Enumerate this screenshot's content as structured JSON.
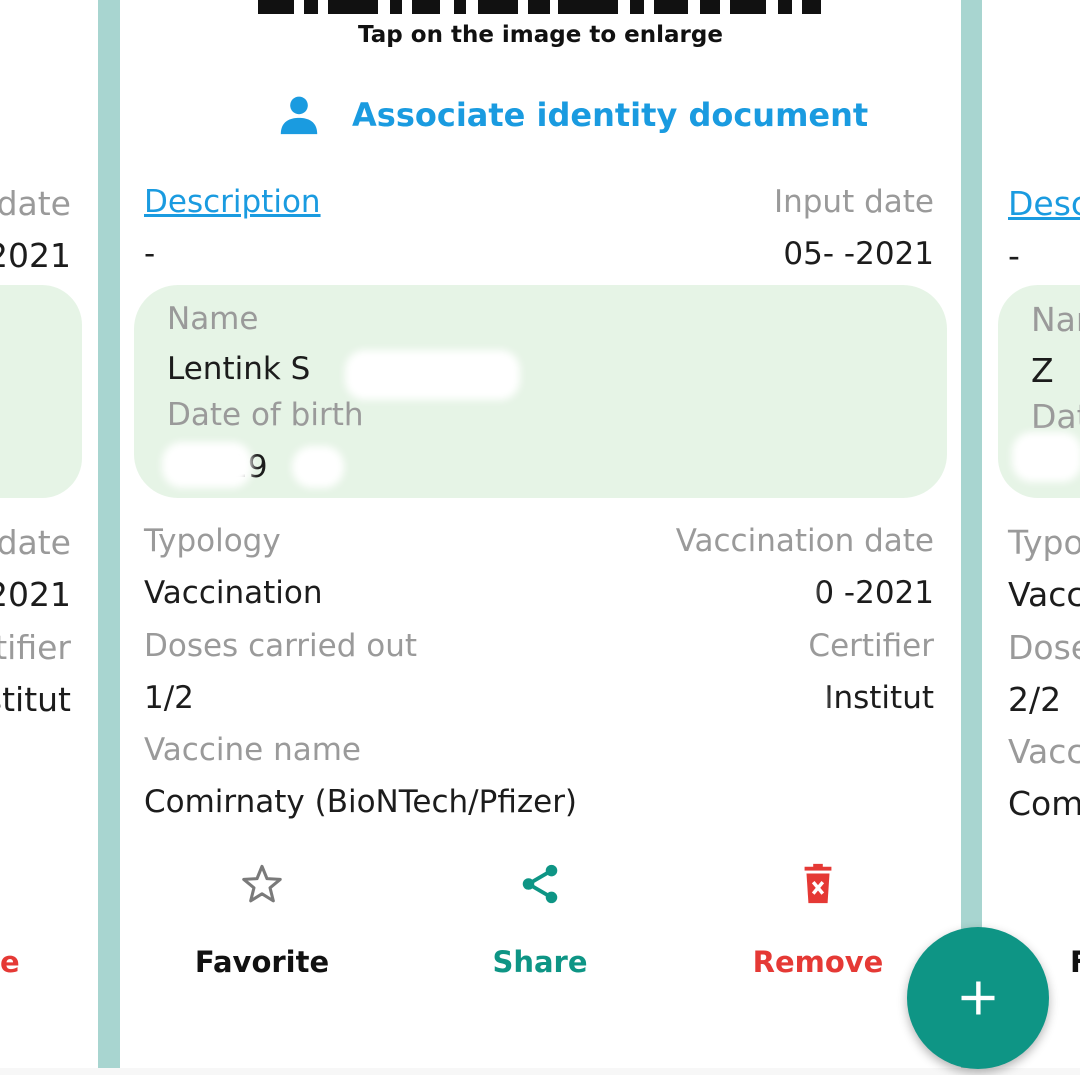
{
  "colors": {
    "accent_blue": "#1a9be0",
    "teal": "#0e9585",
    "danger": "#e53935",
    "identity_bg": "#e6f4e6",
    "strip": "#a8d5d0"
  },
  "card": {
    "tap_hint": "Tap on the image to enlarge",
    "associate": {
      "label": "Associate identity document",
      "icon": "person-icon"
    },
    "description_label": "Description",
    "description_value": "-",
    "input_date_label": "Input date",
    "input_date_value": "05-  -2021",
    "identity": {
      "name_label": "Name",
      "name_value": "Lentink S",
      "dob_label": "Date of birth",
      "dob_value": "-19"
    },
    "typology_label": "Typology",
    "typology_value": "Vaccination",
    "vaccination_date_label": "Vaccination date",
    "vaccination_date_value": "0 -2021",
    "doses_label": "Doses carried out",
    "doses_value": "1/2",
    "certifier_label": "Certifier",
    "certifier_value": "Institut",
    "vaccine_name_label": "Vaccine name",
    "vaccine_name_value": "Comirnaty (BioNTech/Pfizer)",
    "actions": {
      "favorite": {
        "label": "Favorite",
        "icon": "star-outline-icon"
      },
      "share": {
        "label": "Share",
        "icon": "share-icon"
      },
      "remove": {
        "label": "Remove",
        "icon": "trash-icon"
      }
    }
  },
  "left_peek": {
    "date_label_1": "date",
    "date_value_1": "2021",
    "date_label_2": "date",
    "date_value_2": "2021",
    "certifier_label": "tifier",
    "certifier_value": "stitut",
    "action_label": "e"
  },
  "right_peek": {
    "description_label": "Desc",
    "description_value": "-",
    "name_label": "Nar",
    "name_value": "Z",
    "dob_label": "Dat",
    "typology_label": "Typo",
    "typology_value": "Vacc",
    "doses_label": "Dose",
    "doses_value": "2/2",
    "vaccine_label": "Vacc",
    "vaccine_value": "Com",
    "action_label": "F"
  },
  "fab": {
    "icon": "plus-icon"
  }
}
